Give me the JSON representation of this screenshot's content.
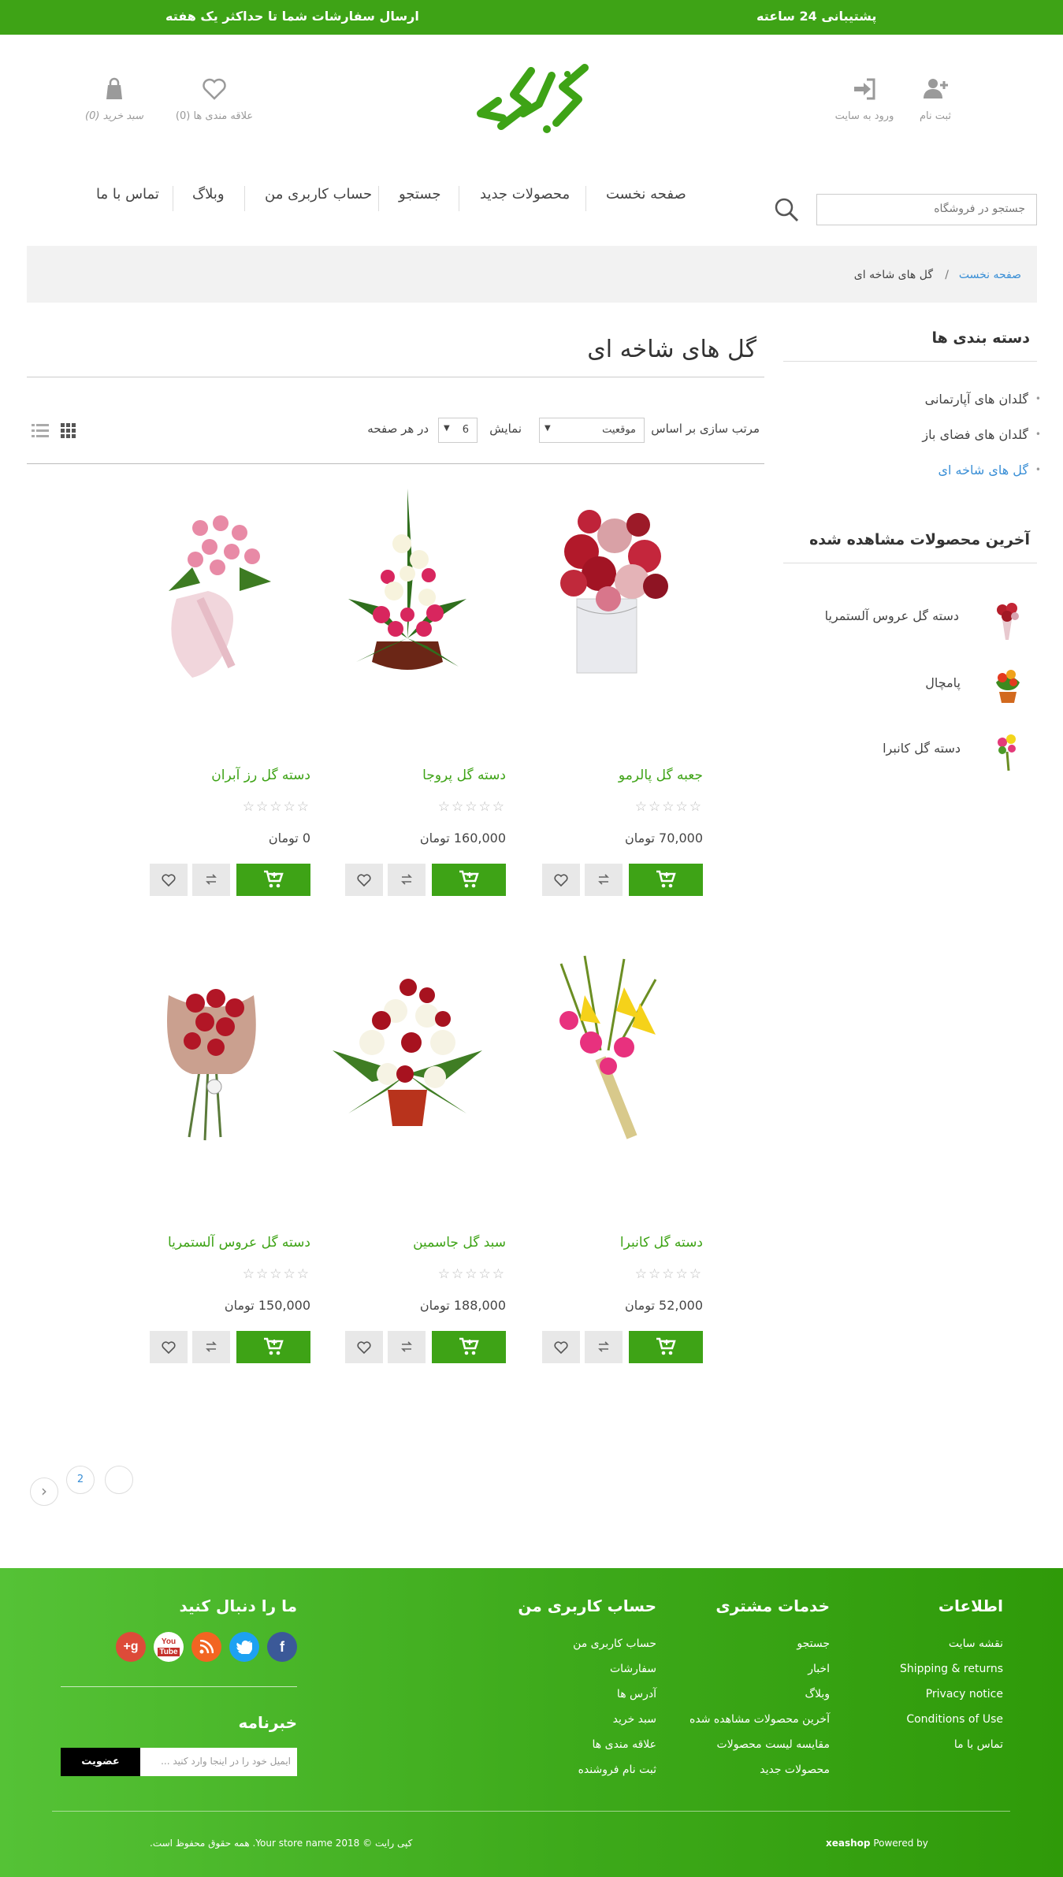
{
  "topbar": {
    "shipping": "ارسال سفارشات شما تا حداکثر یک هفته",
    "support": "پشتیبانی 24 ساعته"
  },
  "header": {
    "cart_label": "سبد خرید (0)",
    "wishlist_label": "علاقه مندی ها (0)",
    "login_label": "ورود به سایت",
    "register_label": "ثبت نام"
  },
  "nav": {
    "items": [
      "صفحه نخست",
      "محصولات جدید",
      "جستجو",
      "حساب کاربری من",
      "وبلاگ",
      "تماس با ما"
    ],
    "search_placeholder": "جستجو در فروشگاه"
  },
  "breadcrumb": {
    "home": "صفحه نخست",
    "separator": "/",
    "current": "گل های شاخه ای"
  },
  "sidebar": {
    "categories_title": "دسته بندی ها",
    "categories": [
      "گلدان های آپارتمانی",
      "گلدان های فضای باز",
      "گل های شاخه ای"
    ],
    "recent_title": "آخرین محصولات مشاهده شده",
    "recent": [
      "دسته گل عروس آلستمریا",
      "پامچال",
      "دسته گل کانبرا"
    ]
  },
  "main": {
    "title": "گل های شاخه ای",
    "sort_label": "مرتب سازی بر اساس",
    "sort_value": "موقعیت",
    "show_label": "نمایش",
    "per_page_value": "6",
    "per_page_label": "در هر صفحه"
  },
  "products": [
    {
      "name": "جعبه گل پالرمو",
      "price": "70,000 تومان",
      "rating": 0
    },
    {
      "name": "دسته گل پروجا",
      "price": "160,000 تومان",
      "rating": 0
    },
    {
      "name": "دسته گل رز آبران",
      "price": "0 تومان",
      "rating": 0
    },
    {
      "name": "دسته گل کانبرا",
      "price": "52,000 تومان",
      "rating": 0
    },
    {
      "name": "سبد گل جاسمین",
      "price": "188,000 تومان",
      "rating": 0
    },
    {
      "name": "دسته گل عروس آلستمریا",
      "price": "150,000 تومان",
      "rating": 0
    }
  ],
  "pagination": {
    "page2": "2",
    "prev": "‹"
  },
  "footer": {
    "info_title": "اطلاعات",
    "info_links": [
      "نقشه سایت",
      "Shipping & returns",
      "Privacy notice",
      "Conditions of Use",
      "تماس با ما"
    ],
    "service_title": "خدمات مشتری",
    "service_links": [
      "جستجو",
      "اخبار",
      "وبلاگ",
      "آخرین محصولات مشاهده شده",
      "مقایسه لیست محصولات",
      "محصولات جدید"
    ],
    "account_title": "حساب کاربری من",
    "account_links": [
      "حساب کاربری من",
      "سفارشات",
      "آدرس ها",
      "سبد خرید",
      "علاقه مندی ها",
      "ثبت نام فروشنده"
    ],
    "follow_title": "ما را دنبال کنید",
    "newsletter_title": "خبرنامه",
    "newsletter_placeholder": "ایمیل خود را در اینجا وارد کنید ...",
    "subscribe_label": "عضویت",
    "copyright": "کپی رایت © 2018 Your store name. همه حقوق محفوظ است.",
    "powered_prefix": "Powered by",
    "powered_brand": "xeashop"
  },
  "colors": {
    "brand_green": "#3ea316",
    "link_blue": "#3a8fd6",
    "facebook": "#3b5998",
    "twitter": "#1da1f2",
    "rss": "#f26522",
    "youtube": "#ffffff",
    "google_plus": "#dd4b39"
  }
}
